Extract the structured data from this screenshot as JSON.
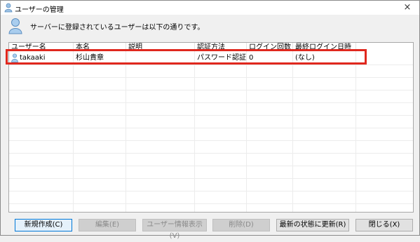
{
  "window": {
    "title": "ユーザーの管理",
    "close": "×"
  },
  "header": {
    "message": "サーバーに登録されているユーザーは以下の通りです。"
  },
  "columns": [
    "ユーザー名",
    "本名",
    "説明",
    "認証方法",
    "ログイン回数",
    "最終ログイン日時"
  ],
  "rows": [
    {
      "username": "takaaki",
      "real_name": "杉山貴章",
      "description": "",
      "auth": "パスワード認証",
      "login_count": "0",
      "last_login": "(なし)"
    }
  ],
  "buttons": {
    "new": "新規作成(C)",
    "edit": "編集(E)",
    "info": "ユーザー情報表示(V)",
    "delete": "削除(D)",
    "refresh": "最新の状態に更新(R)",
    "close": "閉じる(X)"
  },
  "colors": {
    "highlight": "#e0281e",
    "focus": "#0078d7"
  }
}
